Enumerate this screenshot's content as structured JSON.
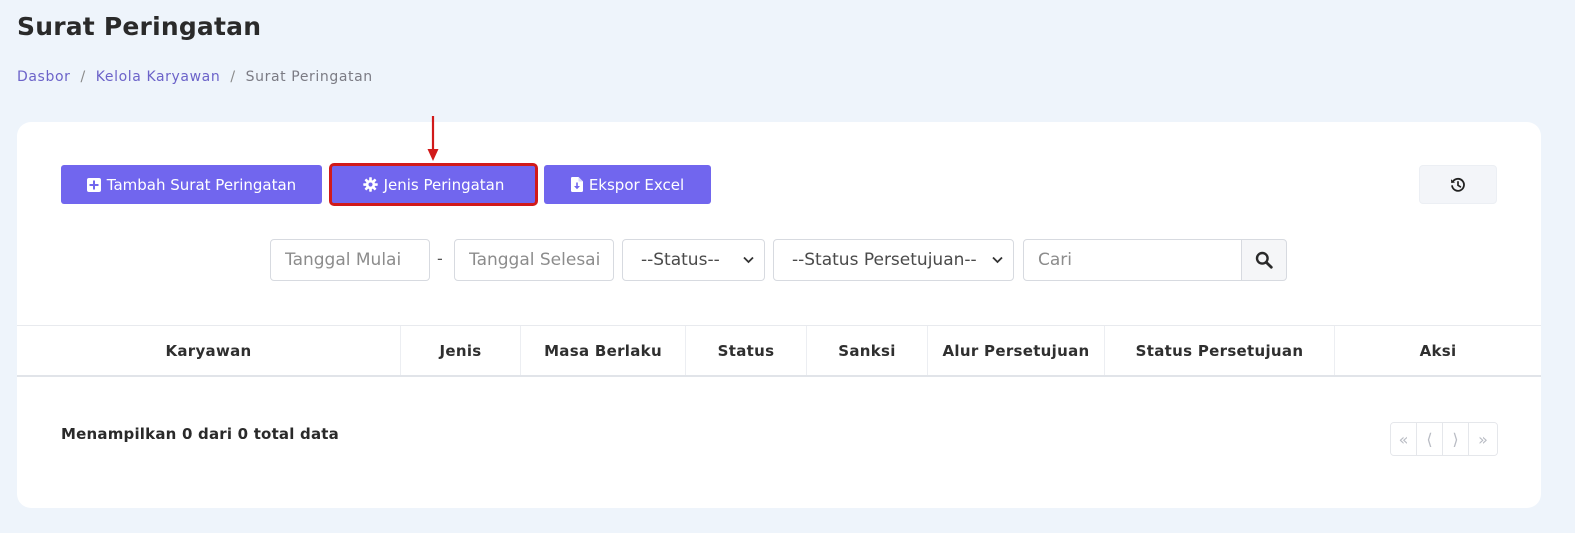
{
  "page": {
    "title": "Surat Peringatan"
  },
  "breadcrumb": {
    "items": [
      "Dasbor",
      "Kelola Karyawan",
      "Surat Peringatan"
    ],
    "separator": "/"
  },
  "toolbar": {
    "add_label": "Tambah Surat Peringatan",
    "type_label": "Jenis Peringatan",
    "export_label": "Ekspor Excel",
    "accent": "#7166ee",
    "highlight": "#d11a1a"
  },
  "filters": {
    "start_placeholder": "Tanggal Mulai",
    "dash": "-",
    "end_placeholder": "Tanggal Selesai",
    "status_selected": "--Status--",
    "approval_selected": "--Status Persetujuan--",
    "search_placeholder": "Cari"
  },
  "table": {
    "columns": [
      "Karyawan",
      "Jenis",
      "Masa Berlaku",
      "Status",
      "Sanksi",
      "Alur Persetujuan",
      "Status Persetujuan",
      "Aksi"
    ]
  },
  "footer": {
    "summary": "Menampilkan 0 dari 0 total data",
    "pager": [
      "«",
      "⟨",
      "⟩",
      "»"
    ]
  }
}
